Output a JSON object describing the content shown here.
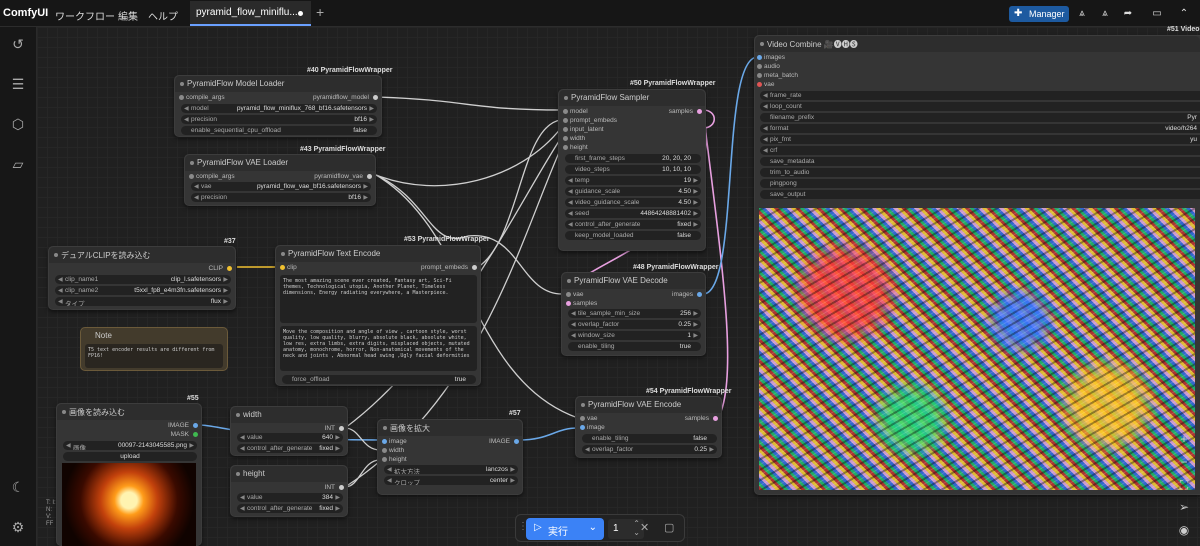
{
  "app": {
    "name": "ComfyUI"
  },
  "menu": [
    "ワークフロー",
    "編集",
    "ヘルプ"
  ],
  "tab": {
    "label": "pyramid_flow_miniflu..."
  },
  "header": {
    "manager_label": "Manager"
  },
  "nodes": {
    "model_loader": {
      "id": "#40 PyramidFlowWrapper",
      "title": "PyramidFlow Model Loader",
      "input": "compile_args",
      "output": "pyramidflow_model",
      "widgets": [
        {
          "label": "model",
          "value": "pyramid_flow_miniflux_768_bf16.safetensors"
        },
        {
          "label": "precision",
          "value": "bf16"
        },
        {
          "label": "enable_sequential_cpu_offload",
          "value": "false"
        }
      ]
    },
    "vae_loader": {
      "id": "#43 PyramidFlowWrapper",
      "title": "PyramidFlow VAE Loader",
      "input": "compile_args",
      "output": "pyramidflow_vae",
      "widgets": [
        {
          "label": "vae",
          "value": "pyramid_flow_vae_bf16.safetensors"
        },
        {
          "label": "precision",
          "value": "bf16"
        }
      ]
    },
    "sampler": {
      "id": "#50 PyramidFlowWrapper",
      "title": "PyramidFlow Sampler",
      "inputs": [
        "model",
        "prompt_embeds",
        "input_latent",
        "width",
        "height"
      ],
      "output": "samples",
      "widgets": [
        {
          "label": "first_frame_steps",
          "value": "20, 20, 20"
        },
        {
          "label": "video_steps",
          "value": "10, 10, 10"
        },
        {
          "label": "temp",
          "value": "19"
        },
        {
          "label": "guidance_scale",
          "value": "4.50"
        },
        {
          "label": "video_guidance_scale",
          "value": "4.50"
        },
        {
          "label": "seed",
          "value": "44864248881402"
        },
        {
          "label": "control_after_generate",
          "value": "fixed"
        },
        {
          "label": "keep_model_loaded",
          "value": "false"
        }
      ]
    },
    "clip_loader": {
      "id": "#37",
      "title": "デュアルCLIPを読み込む",
      "output": "CLIP",
      "widgets": [
        {
          "label": "clip_name1",
          "value": "clip_l.safetensors"
        },
        {
          "label": "clip_name2",
          "value": "t5xxl_fp8_e4m3fn.safetensors"
        },
        {
          "label": "タイプ",
          "value": "flux"
        }
      ]
    },
    "text_encode": {
      "id": "#53 PyramidFlowWrapper",
      "title": "PyramidFlow Text Encode",
      "input": "clip",
      "output": "prompt_embeds",
      "positive": "The most amazing scene ever created, Fantasy art, Sci-Fi themes, Technological utopia, Another Planet, Timeless dimensions, Energy radiating everywhere, a Masterpiece.",
      "negative": "Move the composition and angle of view , cartoon style, worst quality, low quality, blurry, absolute black, absolute white, low res, extra limbs, extra digits, misplaced objects, mutated anatomy, monochrome, horror, Non-anatomical movements of the neck and joints , Abnormal head swing ,Ugly facial deformities",
      "widgets": [
        {
          "label": "force_offload",
          "value": "true"
        }
      ]
    },
    "note": {
      "title": "Note",
      "text": "T5 text encoder results are different from FP16!"
    },
    "vae_decode": {
      "id": "#48 PyramidFlowWrapper",
      "title": "PyramidFlow VAE Decode",
      "inputs": [
        "vae",
        "samples"
      ],
      "output": "images",
      "widgets": [
        {
          "label": "tile_sample_min_size",
          "value": "256"
        },
        {
          "label": "overlap_factor",
          "value": "0.25"
        },
        {
          "label": "window_size",
          "value": "1"
        },
        {
          "label": "enable_tiling",
          "value": "true"
        }
      ]
    },
    "vae_encode": {
      "id": "#54 PyramidFlowWrapper",
      "title": "PyramidFlow VAE Encode",
      "inputs": [
        "vae",
        "image"
      ],
      "output": "samples",
      "widgets": [
        {
          "label": "enable_tiling",
          "value": "false"
        },
        {
          "label": "overlap_factor",
          "value": "0.25"
        }
      ]
    },
    "load_image": {
      "id": "#55",
      "title": "画像を読み込む",
      "outputs": [
        "IMAGE",
        "MASK"
      ],
      "widgets": [
        {
          "label": "画像",
          "value": "00097-2143045585.png"
        }
      ],
      "upload": "upload"
    },
    "width": {
      "title": "width",
      "output": "INT",
      "widgets": [
        {
          "label": "value",
          "value": "640"
        },
        {
          "label": "control_after_generate",
          "value": "fixed"
        }
      ]
    },
    "height": {
      "title": "height",
      "output": "INT",
      "widgets": [
        {
          "label": "value",
          "value": "384"
        },
        {
          "label": "control_after_generate",
          "value": "fixed"
        }
      ]
    },
    "upscale": {
      "id": "#57",
      "title": "画像を拡大",
      "inputs": [
        "image",
        "width",
        "height"
      ],
      "output": "IMAGE",
      "widgets": [
        {
          "label": "拡大方法",
          "value": "lanczos"
        },
        {
          "label": "クロップ",
          "value": "center"
        }
      ]
    },
    "video_combine": {
      "id": "#51 Video",
      "title": "Video Combine 🎥🅥🅗🅢",
      "inputs": [
        "images",
        "audio",
        "meta_batch",
        "vae"
      ],
      "widgets": [
        {
          "label": "frame_rate",
          "value": ""
        },
        {
          "label": "loop_count",
          "value": ""
        },
        {
          "label": "filename_prefix",
          "value": "Pyr"
        },
        {
          "label": "format",
          "value": "video/h264"
        },
        {
          "label": "pix_fmt",
          "value": "yu"
        },
        {
          "label": "crf",
          "value": ""
        },
        {
          "label": "save_metadata",
          "value": ""
        },
        {
          "label": "trim_to_audio",
          "value": ""
        },
        {
          "label": "pingpong",
          "value": ""
        },
        {
          "label": "save_output",
          "value": ""
        }
      ]
    }
  },
  "runbar": {
    "run_label": "実行",
    "count": "1"
  },
  "sidebar_bottom_text": "T: I: N: V: FF",
  "colors": {
    "accent": "#3b82f6",
    "manager": "#1d5aa0",
    "canvas": "#202020",
    "node": "#353535",
    "link_blue": "#6aa8e8",
    "link_pink": "#e8a0e0",
    "link_white": "#cfcfcf",
    "link_yellow": "#f0c030"
  }
}
